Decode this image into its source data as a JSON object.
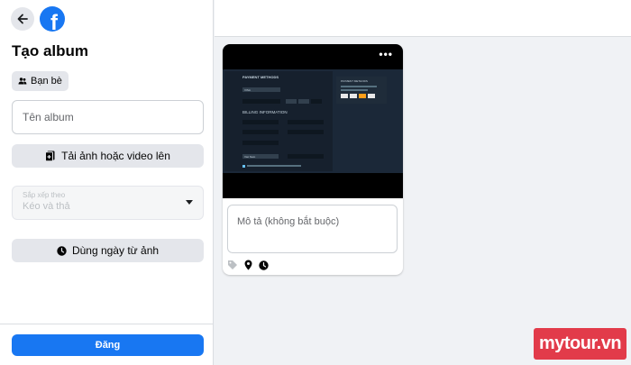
{
  "header": {
    "logo_letter": "f"
  },
  "album": {
    "title": "Tạo album",
    "privacy_label": "Bạn bè",
    "name_placeholder": "Tên album",
    "upload_label": "Tải ảnh hoặc video lên",
    "sort": {
      "label": "Sắp xếp theo",
      "value": "Kéo và thả"
    },
    "date_label": "Dùng ngày từ ảnh",
    "post_label": "Đăng"
  },
  "photo_card": {
    "description_placeholder": "Mô tả (không bắt buộc)",
    "screen": {
      "left_title": "PAYMENT METHODS",
      "right_title": "PAYMENT METHODS",
      "billing_title": "BILLING INFORMATION",
      "card_type": "VISA",
      "country": "Viet Nam"
    }
  },
  "watermark": "mytour.vn",
  "colors": {
    "accent": "#1877f2",
    "watermark": "#e23b4a"
  }
}
